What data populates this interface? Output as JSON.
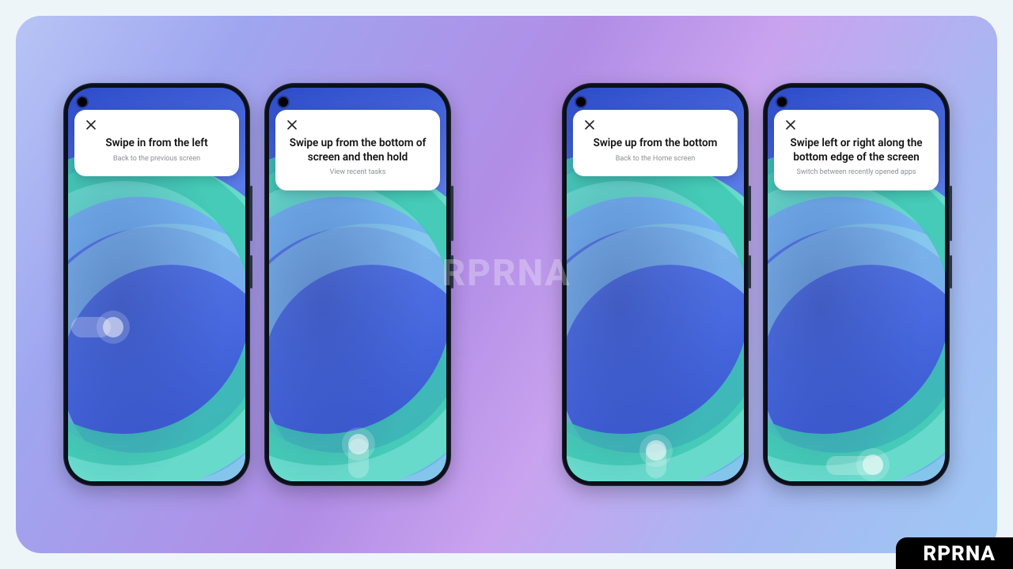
{
  "watermark_center": "RPRNA",
  "watermark_corner": "RPRNA",
  "close_icon_name": "close-icon",
  "phones": [
    {
      "title": "Swipe in from the left",
      "subtitle": "Back to the previous screen",
      "gesture": "swipe-from-left"
    },
    {
      "title": "Swipe up from the bottom of screen and then hold",
      "subtitle": "View recent tasks",
      "gesture": "swipe-up-hold"
    },
    {
      "title": "Swipe up from the bottom",
      "subtitle": "Back to the Home screen",
      "gesture": "swipe-up"
    },
    {
      "title": "Swipe left or right along the bottom edge of the screen",
      "subtitle": "Switch between recently opened apps",
      "gesture": "swipe-horizontal-bottom"
    }
  ]
}
